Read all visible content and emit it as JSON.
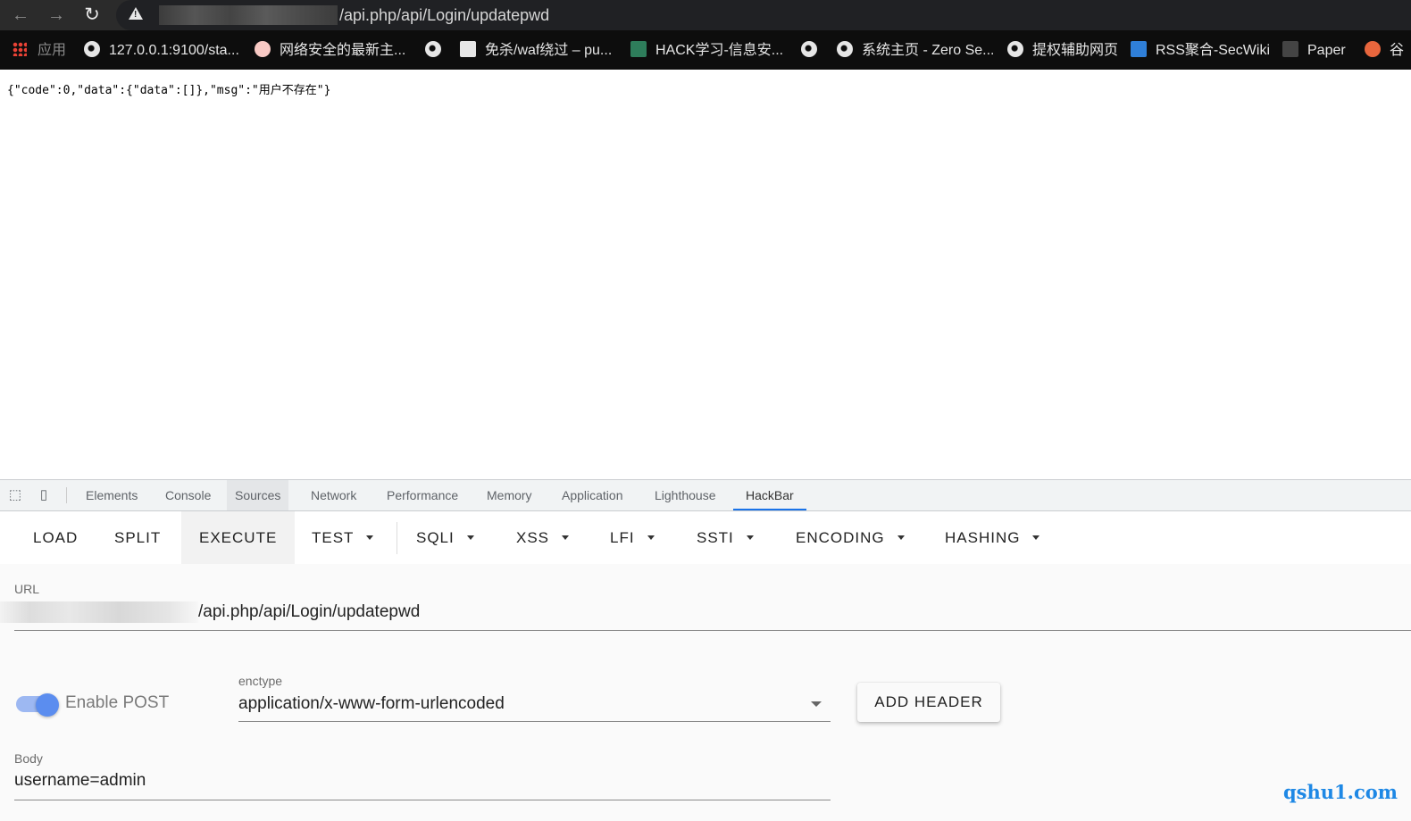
{
  "browser": {
    "address_url": "/api.php/api/Login/updatepwd",
    "nav": {
      "back": "←",
      "forward": "→",
      "reload": "↻"
    }
  },
  "bookmarks": [
    {
      "label": "应用",
      "icon": "apps-grid-icon"
    },
    {
      "label": "127.0.0.1:9100/sta...",
      "icon": "globe-icon"
    },
    {
      "label": "网络安全的最新主...",
      "icon": "chat-icon"
    },
    {
      "label": "",
      "icon": "globe-icon"
    },
    {
      "label": "免杀/waf绕过 – pu...",
      "icon": "page-icon"
    },
    {
      "label": "HACK学习-信息安...",
      "icon": "hack-icon"
    },
    {
      "label": "",
      "icon": "globe-icon"
    },
    {
      "label": "系统主页 - Zero Se...",
      "icon": "globe-icon"
    },
    {
      "label": "提权辅助网页",
      "icon": "globe-icon"
    },
    {
      "label": "RSS聚合-SecWiki",
      "icon": "secwiki-icon"
    },
    {
      "label": "Paper",
      "icon": "paper-icon"
    },
    {
      "label": "谷",
      "icon": "flame-icon"
    }
  ],
  "page": {
    "response_text": "{\"code\":0,\"data\":{\"data\":[]},\"msg\":\"用户不存在\"}"
  },
  "devtools": {
    "tabs": [
      "Elements",
      "Console",
      "Sources",
      "Network",
      "Performance",
      "Memory",
      "Application",
      "Lighthouse",
      "HackBar"
    ],
    "active_tab": "HackBar"
  },
  "hackbar": {
    "buttons": [
      "LOAD",
      "SPLIT",
      "EXECUTE",
      "TEST",
      "SQLI",
      "XSS",
      "LFI",
      "SSTI",
      "ENCODING",
      "HASHING"
    ],
    "url_label": "URL",
    "url_value": "/api.php/api/Login/updatepwd",
    "enable_post_label": "Enable POST",
    "enctype_label": "enctype",
    "enctype_value": "application/x-www-form-urlencoded",
    "add_header_label": "ADD HEADER",
    "body_label": "Body",
    "body_value": "username=admin"
  },
  "watermark": "qshu1.com"
}
